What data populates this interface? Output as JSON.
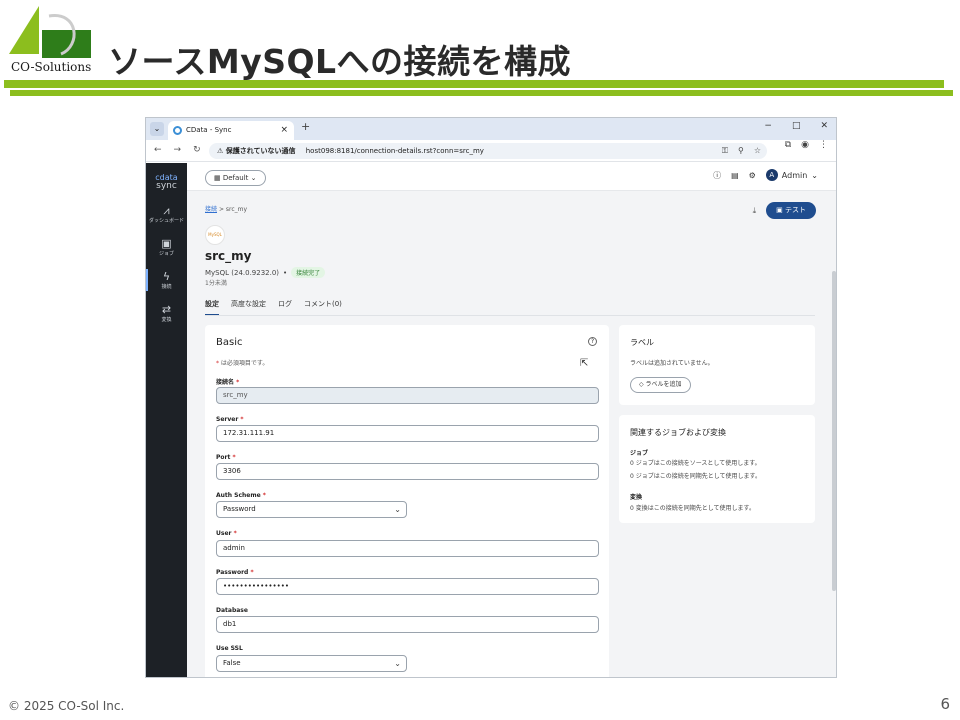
{
  "slide": {
    "title": "ソースMySQLへの接続を構成",
    "logo_text": "CO-Solutions",
    "footer": "© 2025 CO-Sol Inc.",
    "page_number": "6",
    "colors": {
      "accent_green": "#8cbe1e",
      "nav_dark": "#1d2126",
      "primary_button": "#1f4d8f"
    }
  },
  "browser": {
    "tab_title": "CData - Sync",
    "tab_close": "×",
    "new_tab": "+",
    "security_warning": "保護されていない通信",
    "url": "host098:8181/connection-details.rst?conn=src_my",
    "window_controls": [
      "−",
      "□",
      "✕"
    ]
  },
  "app": {
    "brand_top": "cdata",
    "brand_bottom": "sync",
    "sidebar": [
      {
        "icon": "chart-icon",
        "glyph": "📈",
        "label": "ダッシュボード"
      },
      {
        "icon": "briefcase-icon",
        "glyph": "💼",
        "label": "ジョブ"
      },
      {
        "icon": "plug-icon",
        "glyph": "⚡",
        "label": "接続"
      },
      {
        "icon": "swap-icon",
        "glyph": "⇄",
        "label": "変換"
      }
    ],
    "workspace": "Default",
    "user": "Admin",
    "avatar_letter": "A"
  },
  "connection": {
    "breadcrumb_root": "接続",
    "breadcrumb_sep": ">",
    "breadcrumb_current": "src_my",
    "test_button": "テスト",
    "name": "src_my",
    "driver": "MySQL (24.0.9232.0)",
    "status": "接続完了",
    "updated": "1分未満",
    "tabs": [
      "設定",
      "高度な設定",
      "ログ",
      "コメント(0)"
    ]
  },
  "form": {
    "title": "Basic",
    "required_note": "は必須項目です。",
    "fields": {
      "name_label": "接続名",
      "name_value": "src_my",
      "server_label": "Server",
      "server_value": "172.31.111.91",
      "port_label": "Port",
      "port_value": "3306",
      "auth_label": "Auth Scheme",
      "auth_value": "Password",
      "user_label": "User",
      "user_value": "admin",
      "password_label": "Password",
      "password_value": "••••••••••••••••",
      "database_label": "Database",
      "database_value": "db1",
      "ssl_label": "Use SSL",
      "ssl_value": "False"
    }
  },
  "labels_card": {
    "title": "ラベル",
    "empty_text": "ラベルは追加されていません。",
    "add_button": "ラベルを追加"
  },
  "related_card": {
    "title": "関連するジョブおよび変換",
    "jobs_heading": "ジョブ",
    "jobs_source": "0 ジョブはこの接続をソースとして使用します。",
    "jobs_dest": "0 ジョブはこの接続を同期先として使用します。",
    "transforms_heading": "変換",
    "transforms_dest": "0 変換はこの接続を同期先として使用します。"
  }
}
